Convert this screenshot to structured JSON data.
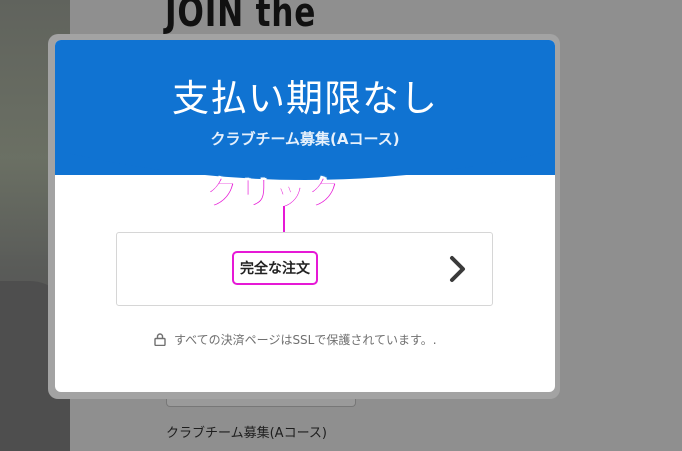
{
  "background": {
    "heading": "JOIN the",
    "field_label": "クラブチーム募集(Aコース)"
  },
  "modal": {
    "title": "支払い期限なし",
    "subtitle": "クラブチーム募集(Aコース)",
    "order_button_label": "完全な注文",
    "secure_note": "すべての決済ページはSSLで保護されています。.",
    "header_color": "#1073d2"
  },
  "annotation": {
    "text": "クリック",
    "color": "#e619d6"
  },
  "icons": {
    "order_arrow": "chevron-right-icon",
    "secure": "lock-icon",
    "annotation_arrow": "arrow-down-icon"
  }
}
